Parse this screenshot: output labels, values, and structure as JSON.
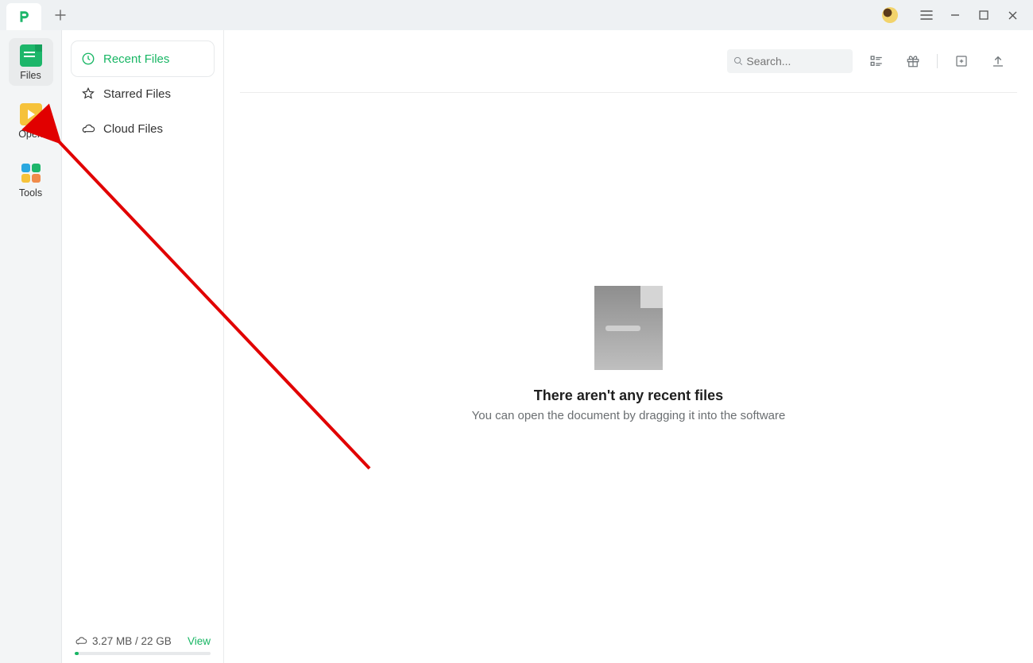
{
  "titlebar": {
    "new_tab_tooltip": "New tab"
  },
  "rail": {
    "items": [
      {
        "label": "Files"
      },
      {
        "label": "Open"
      },
      {
        "label": "Tools"
      }
    ]
  },
  "sidebar": {
    "items": [
      {
        "label": "Recent Files"
      },
      {
        "label": "Starred Files"
      },
      {
        "label": "Cloud Files"
      }
    ],
    "storage_text": "3.27 MB / 22 GB",
    "view_label": "View"
  },
  "toolbar": {
    "search_placeholder": "Search..."
  },
  "empty": {
    "title": "There aren't any recent files",
    "subtitle": "You can open the document by dragging it into the software"
  }
}
